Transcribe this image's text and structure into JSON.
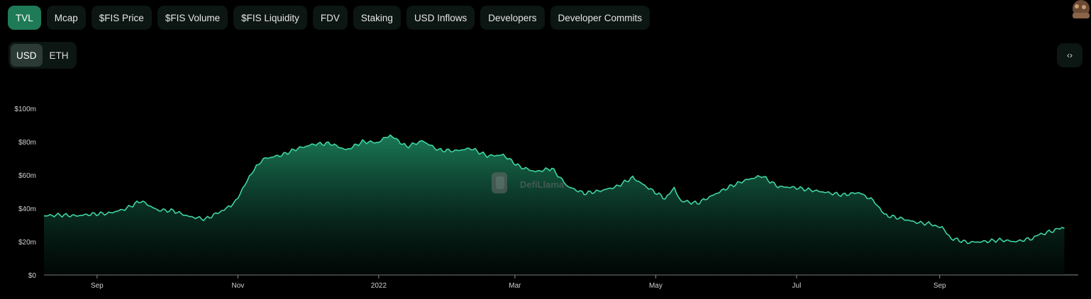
{
  "tabs": [
    {
      "label": "TVL",
      "active": true
    },
    {
      "label": "Mcap",
      "active": false
    },
    {
      "label": "$FIS Price",
      "active": false
    },
    {
      "label": "$FIS Volume",
      "active": false
    },
    {
      "label": "$FIS Liquidity",
      "active": false
    },
    {
      "label": "FDV",
      "active": false
    },
    {
      "label": "Staking",
      "active": false
    },
    {
      "label": "USD Inflows",
      "active": false
    },
    {
      "label": "Developers",
      "active": false
    },
    {
      "label": "Developer Commits",
      "active": false
    }
  ],
  "currency": {
    "options": [
      {
        "label": "USD",
        "active": true
      },
      {
        "label": "ETH",
        "active": false
      }
    ]
  },
  "embed": {
    "icon": "code-brackets-icon",
    "label": "‹›"
  },
  "watermark": {
    "text": "DefiLlama",
    "icon": "llama-logo-icon"
  },
  "colors": {
    "accent": "#1f7a57",
    "line": "#3fd5a0",
    "tab_bg": "#0c1612",
    "background": "#000000"
  },
  "chart_data": {
    "type": "area",
    "unit": "USD",
    "ylim": [
      0,
      100
    ],
    "y_ticks": [
      "$0",
      "$20m",
      "$40m",
      "$60m",
      "$80m",
      "$100m"
    ],
    "x_ticks": [
      "Sep",
      "Nov",
      "2022",
      "Mar",
      "May",
      "Jul",
      "Sep"
    ],
    "x_tick_dates": [
      "2021-09-01",
      "2021-11-01",
      "2022-01-01",
      "2022-03-01",
      "2022-05-01",
      "2022-07-01",
      "2022-09-01"
    ],
    "x_start": "2021-08-09",
    "x_end": "2022-10-31",
    "grid": false,
    "legend": "none",
    "series": [
      {
        "points": [
          [
            "2021-08-09",
            35.5
          ],
          [
            "2021-08-16",
            36.0
          ],
          [
            "2021-08-23",
            35.5
          ],
          [
            "2021-08-30",
            36.5
          ],
          [
            "2021-09-06",
            37.0
          ],
          [
            "2021-09-13",
            39.5
          ],
          [
            "2021-09-20",
            44.5
          ],
          [
            "2021-09-27",
            39.0
          ],
          [
            "2021-10-04",
            38.5
          ],
          [
            "2021-10-11",
            35.0
          ],
          [
            "2021-10-18",
            33.5
          ],
          [
            "2021-10-25",
            38.5
          ],
          [
            "2021-10-29",
            41.0
          ],
          [
            "2021-11-01",
            47.0
          ],
          [
            "2021-11-05",
            56.0
          ],
          [
            "2021-11-09",
            66.0
          ],
          [
            "2021-11-13",
            70.0
          ],
          [
            "2021-11-20",
            72.0
          ],
          [
            "2021-11-27",
            76.0
          ],
          [
            "2021-12-04",
            78.5
          ],
          [
            "2021-12-11",
            79.0
          ],
          [
            "2021-12-18",
            75.0
          ],
          [
            "2021-12-25",
            80.0
          ],
          [
            "2022-01-01",
            79.5
          ],
          [
            "2022-01-06",
            84.0
          ],
          [
            "2022-01-13",
            77.0
          ],
          [
            "2022-01-20",
            80.5
          ],
          [
            "2022-01-27",
            75.0
          ],
          [
            "2022-02-03",
            74.5
          ],
          [
            "2022-02-10",
            76.0
          ],
          [
            "2022-02-17",
            71.5
          ],
          [
            "2022-02-24",
            72.0
          ],
          [
            "2022-03-03",
            65.0
          ],
          [
            "2022-03-10",
            62.0
          ],
          [
            "2022-03-17",
            64.0
          ],
          [
            "2022-03-24",
            53.0
          ],
          [
            "2022-03-31",
            49.0
          ],
          [
            "2022-04-07",
            50.5
          ],
          [
            "2022-04-14",
            53.0
          ],
          [
            "2022-04-21",
            58.5
          ],
          [
            "2022-04-28",
            52.0
          ],
          [
            "2022-05-05",
            46.0
          ],
          [
            "2022-05-09",
            51.5
          ],
          [
            "2022-05-12",
            44.5
          ],
          [
            "2022-05-19",
            43.0
          ],
          [
            "2022-05-26",
            48.0
          ],
          [
            "2022-06-02",
            53.0
          ],
          [
            "2022-06-09",
            57.0
          ],
          [
            "2022-06-16",
            59.5
          ],
          [
            "2022-06-23",
            53.0
          ],
          [
            "2022-06-30",
            52.5
          ],
          [
            "2022-07-07",
            51.0
          ],
          [
            "2022-07-14",
            49.5
          ],
          [
            "2022-07-21",
            48.0
          ],
          [
            "2022-07-28",
            49.5
          ],
          [
            "2022-08-04",
            44.0
          ],
          [
            "2022-08-08",
            36.0
          ],
          [
            "2022-08-15",
            34.0
          ],
          [
            "2022-08-22",
            31.5
          ],
          [
            "2022-08-29",
            30.5
          ],
          [
            "2022-09-02",
            28.0
          ],
          [
            "2022-09-06",
            22.0
          ],
          [
            "2022-09-13",
            19.5
          ],
          [
            "2022-09-20",
            20.0
          ],
          [
            "2022-09-27",
            21.0
          ],
          [
            "2022-10-04",
            20.0
          ],
          [
            "2022-10-11",
            22.0
          ],
          [
            "2022-10-14",
            24.0
          ],
          [
            "2022-10-21",
            27.0
          ],
          [
            "2022-10-25",
            28.0
          ]
        ]
      }
    ]
  }
}
